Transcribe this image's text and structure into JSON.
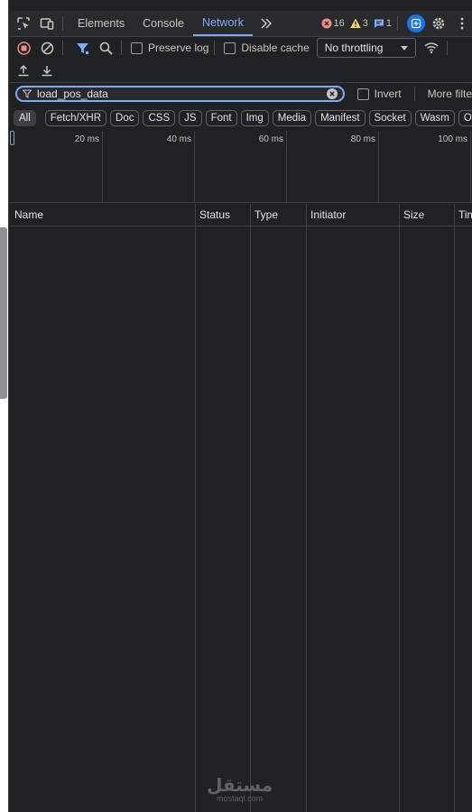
{
  "tabs": {
    "items": [
      "Elements",
      "Console",
      "Network"
    ],
    "active": "Network"
  },
  "badges": {
    "errors": "16",
    "warnings": "3",
    "messages": "1"
  },
  "toolbar": {
    "preserve_log": "Preserve log",
    "disable_cache": "Disable cache",
    "throttling": "No throttling"
  },
  "filter": {
    "value": "load_pos_data",
    "invert": "Invert",
    "more_filters": "More filte"
  },
  "chips": [
    "All",
    "Fetch/XHR",
    "Doc",
    "CSS",
    "JS",
    "Font",
    "Img",
    "Media",
    "Manifest",
    "Socket",
    "Wasm",
    "Othe"
  ],
  "timeline": {
    "ticks": [
      "20 ms",
      "40 ms",
      "60 ms",
      "80 ms",
      "100 ms"
    ]
  },
  "table": {
    "columns": [
      "Name",
      "Status",
      "Type",
      "Initiator",
      "Size",
      "Tim"
    ]
  },
  "watermark": {
    "arabic": "مستقل",
    "latin": "mostaql.com"
  },
  "colors": {
    "accent": "#7cacf8",
    "error": "#f28b82",
    "warning": "#fdd663",
    "record": "#f28b82",
    "background": "#202124"
  }
}
